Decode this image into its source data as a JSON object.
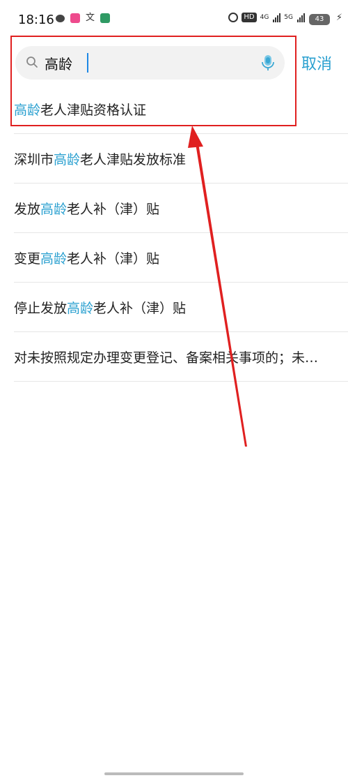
{
  "status_bar": {
    "time": "18:16",
    "left_icons": [
      "wechat-icon",
      "bilibili-icon",
      "text-icon",
      "app-icon"
    ],
    "text_icon_label": "文",
    "right_icons": [
      "alarm-icon",
      "hd-icon",
      "signal-4g-icon",
      "signal-5g-icon",
      "battery-icon",
      "charging-bolt-icon"
    ],
    "hd_label": "HD",
    "network_4g": "4G",
    "network_5g": "5G",
    "battery_level": "43"
  },
  "search": {
    "value": "高龄",
    "cancel_label": "取消"
  },
  "suggestions": [
    {
      "before": "",
      "highlight": "高龄",
      "after": "老人津贴资格认证"
    },
    {
      "before": "深圳市",
      "highlight": "高龄",
      "after": "老人津贴发放标准"
    },
    {
      "before": "发放",
      "highlight": "高龄",
      "after": "老人补（津）贴"
    },
    {
      "before": "变更",
      "highlight": "高龄",
      "after": "老人补（津）贴"
    },
    {
      "before": "停止发放",
      "highlight": "高龄",
      "after": "老人补（津）贴"
    },
    {
      "before": "对未按照规定办理变更登记、备案相关事项的；未…",
      "highlight": "",
      "after": ""
    }
  ],
  "colors": {
    "accent": "#2aa0d0",
    "annotation": "#e02020"
  }
}
